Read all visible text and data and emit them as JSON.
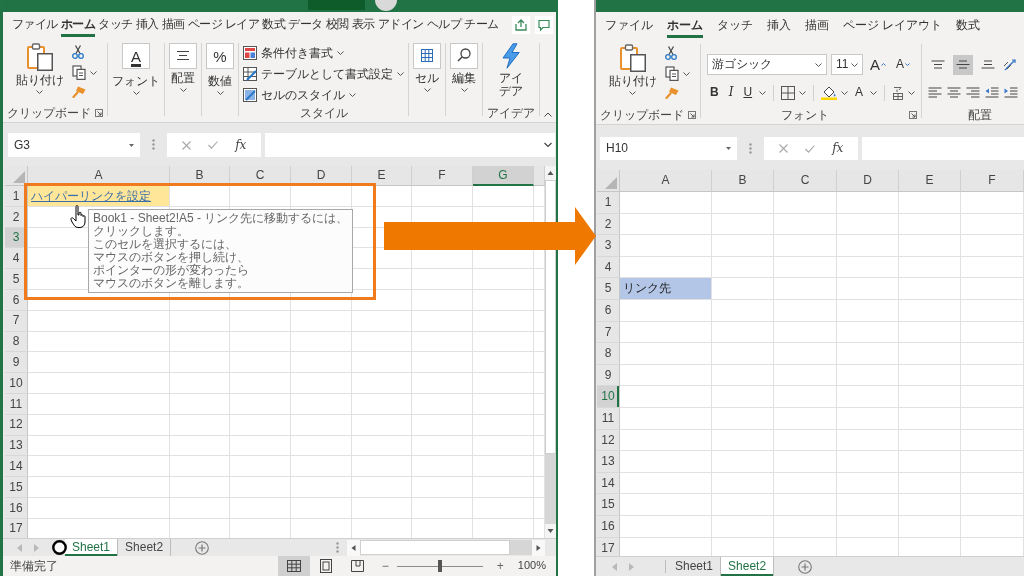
{
  "left_window": {
    "ribbon_tabs": [
      {
        "label": "ファイル",
        "selected": false
      },
      {
        "label": "ホーム",
        "selected": true
      },
      {
        "label": "タッチ",
        "selected": false
      },
      {
        "label": "挿入",
        "selected": false
      },
      {
        "label": "描画",
        "selected": false
      },
      {
        "label": "ページ レイア",
        "selected": false
      },
      {
        "label": "数式",
        "selected": false
      },
      {
        "label": "データ",
        "selected": false
      },
      {
        "label": "校閲",
        "selected": false
      },
      {
        "label": "表示",
        "selected": false
      },
      {
        "label": "アドイン",
        "selected": false
      },
      {
        "label": "ヘルプ",
        "selected": false
      },
      {
        "label": "チーム",
        "selected": false
      }
    ],
    "ribbon_groups": [
      {
        "kind": "clipboard",
        "paste": "貼り付け",
        "label": "クリップボード"
      },
      {
        "kind": "font",
        "button": "フォント",
        "glyph": "A"
      },
      {
        "kind": "alignment",
        "button": "配置"
      },
      {
        "kind": "number",
        "button": "数値",
        "glyph": "%"
      },
      {
        "kind": "styles",
        "items": [
          {
            "kind": "conditional",
            "label": "条件付き書式"
          },
          {
            "kind": "table",
            "label": "テーブルとして書式設定"
          },
          {
            "kind": "cell_styles",
            "label": "セルのスタイル"
          }
        ],
        "label": "スタイル"
      },
      {
        "kind": "cells",
        "button": "セル"
      },
      {
        "kind": "editing",
        "button": "編集"
      },
      {
        "kind": "ideas",
        "button": "アイデア",
        "label": "アイデア"
      }
    ],
    "formula_bar": {
      "name_box": "G3",
      "insert_function": "fx"
    },
    "columns": [
      {
        "label": "A",
        "selected": false
      },
      {
        "label": "B",
        "selected": false
      },
      {
        "label": "C",
        "selected": false
      },
      {
        "label": "D",
        "selected": false
      },
      {
        "label": "E",
        "selected": false
      },
      {
        "label": "F",
        "selected": false
      },
      {
        "label": "G",
        "selected": true
      }
    ],
    "rows": [
      {
        "label": "1",
        "selected": false,
        "cells": [
          {
            "text": "ハイパーリンクを設定",
            "link": true,
            "color": "#ffe699"
          }
        ]
      },
      {
        "label": "2",
        "selected": false
      },
      {
        "label": "3",
        "selected": true
      },
      {
        "label": "4",
        "selected": false
      },
      {
        "label": "5",
        "selected": false
      },
      {
        "label": "6",
        "selected": false
      },
      {
        "label": "7",
        "selected": false
      },
      {
        "label": "8",
        "selected": false
      },
      {
        "label": "9",
        "selected": false
      },
      {
        "label": "10",
        "selected": false
      },
      {
        "label": "11",
        "selected": false
      },
      {
        "label": "12",
        "selected": false
      },
      {
        "label": "13",
        "selected": false
      },
      {
        "label": "14",
        "selected": false
      },
      {
        "label": "15",
        "selected": false
      },
      {
        "label": "16",
        "selected": false
      },
      {
        "label": "17",
        "selected": false
      }
    ],
    "tooltip": {
      "lines": [
        "Book1 - Sheet2!A5 - リンク先に移動するには、",
        "クリックします。",
        "このセルを選択するには、",
        "マウスのボタンを押し続け、",
        "ポインターの形が変わったら",
        "マウスのボタンを離します。"
      ]
    },
    "sheet_tabs": [
      {
        "label": "Sheet1",
        "selected": true
      },
      {
        "label": "Sheet2",
        "selected": false
      }
    ],
    "status_bar": {
      "text": "準備完了",
      "view_buttons": [
        {
          "kind": "normal",
          "selected": true
        },
        {
          "kind": "page_layout",
          "selected": false
        },
        {
          "kind": "page_break",
          "selected": false
        }
      ],
      "zoom": {
        "minus": "−",
        "plus": "+",
        "level": 0.5,
        "reading": "100%"
      }
    }
  },
  "right_window": {
    "ribbon_tabs": [
      {
        "label": "ファイル",
        "selected": false
      },
      {
        "label": "ホーム",
        "selected": true
      },
      {
        "label": "タッチ",
        "selected": false
      },
      {
        "label": "挿入",
        "selected": false
      },
      {
        "label": "描画",
        "selected": false
      },
      {
        "label": "ページ レイアウト",
        "selected": false
      },
      {
        "label": "数式",
        "selected": false
      }
    ],
    "ribbon_groups": [
      {
        "kind": "clipboard",
        "paste": "貼り付け",
        "label": "クリップボード"
      },
      {
        "kind": "font_controls",
        "font_name": "游ゴシック",
        "font_size": "11",
        "grow": "A",
        "shrink": "A",
        "bold": "B",
        "italic": "I",
        "underline": "U",
        "font_color": "A",
        "label": "フォント"
      },
      {
        "kind": "alignment_controls",
        "vertical": [
          {
            "kind": "top",
            "selected": false
          },
          {
            "kind": "middle",
            "selected": true
          },
          {
            "kind": "bottom",
            "selected": false
          }
        ],
        "label": "配置"
      }
    ],
    "formula_bar": {
      "name_box": "H10",
      "insert_function": "fx"
    },
    "columns": [
      {
        "label": "A",
        "selected": false
      },
      {
        "label": "B",
        "selected": false
      },
      {
        "label": "C",
        "selected": false
      },
      {
        "label": "D",
        "selected": false
      },
      {
        "label": "E",
        "selected": false
      },
      {
        "label": "F",
        "selected": false
      }
    ],
    "rows": [
      {
        "label": "1",
        "selected": false
      },
      {
        "label": "2",
        "selected": false
      },
      {
        "label": "3",
        "selected": false
      },
      {
        "label": "4",
        "selected": false
      },
      {
        "label": "5",
        "selected": false,
        "cells": [
          {
            "text": "リンク先",
            "link": false,
            "color": "#b4c6e7"
          }
        ]
      },
      {
        "label": "6",
        "selected": false
      },
      {
        "label": "7",
        "selected": false
      },
      {
        "label": "8",
        "selected": false
      },
      {
        "label": "9",
        "selected": false
      },
      {
        "label": "10",
        "selected": true
      },
      {
        "label": "11",
        "selected": false
      },
      {
        "label": "12",
        "selected": false
      },
      {
        "label": "13",
        "selected": false
      },
      {
        "label": "14",
        "selected": false
      },
      {
        "label": "15",
        "selected": false
      },
      {
        "label": "16",
        "selected": false
      },
      {
        "label": "17",
        "selected": false
      }
    ],
    "sheet_tabs": [
      {
        "label": "Sheet1",
        "selected": false
      },
      {
        "label": "Sheet2",
        "selected": true
      }
    ]
  }
}
